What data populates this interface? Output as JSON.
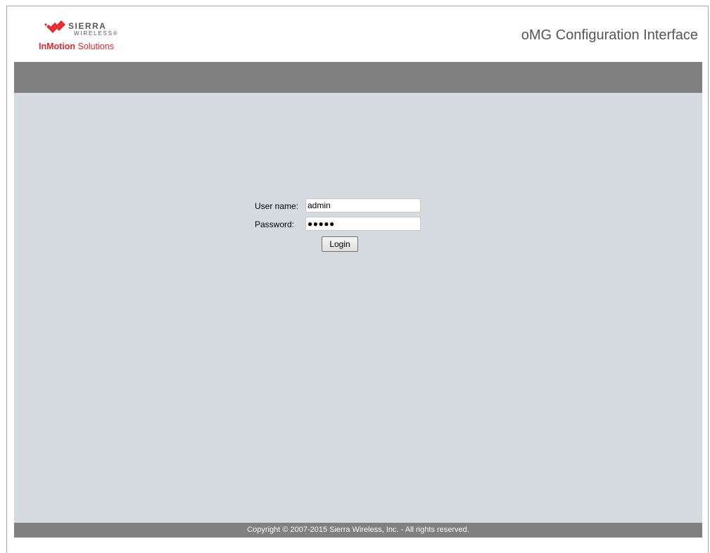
{
  "header": {
    "logo": {
      "brand": "SIERRA",
      "sub": "WIRELESS",
      "trademark": "®",
      "tag_bold": "InMotion",
      "tag_rest": " Solutions"
    },
    "title": "oMG Configuration Interface"
  },
  "login": {
    "username_label": "User name:",
    "username_value": "admin",
    "password_label": "Password:",
    "password_masked": "●●●●●",
    "login_label": "Login"
  },
  "footer": {
    "copyright": "Copyright © 2007-2015 Sierra Wireless, Inc. - All rights reserved."
  },
  "colors": {
    "brand_red": "#e3262f",
    "nav_gray": "#808080",
    "content_bg": "#d5dbe1"
  }
}
